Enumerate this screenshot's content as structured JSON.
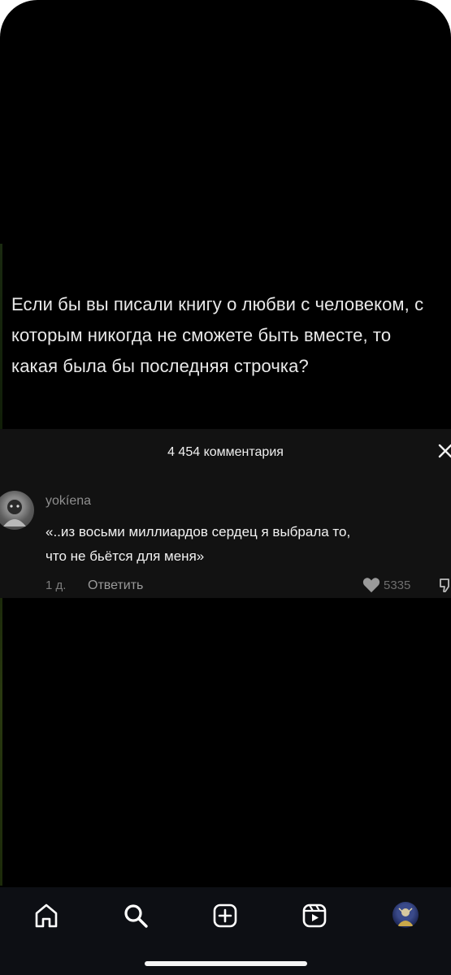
{
  "post": {
    "question": "Если бы вы писали книгу о любви с человеком, с которым никогда не сможете быть вместе, то какая была бы последняя строчка?"
  },
  "comments": {
    "count_label": "4 454 комментария",
    "items": [
      {
        "username": "yokíena",
        "text": "«..из восьми миллиардов сердец я выбрала то,\nчто не бьётся для меня»",
        "time": "1 д.",
        "reply_label": "Ответить",
        "likes": "5335"
      }
    ]
  },
  "tabbar": {
    "items": [
      "home-icon",
      "search-icon",
      "create-icon",
      "reels-icon",
      "profile-avatar"
    ]
  },
  "colors": {
    "background": "#000000",
    "panel": "#121212",
    "tabbar": "#0d0f14",
    "text": "#e9e9e9"
  }
}
